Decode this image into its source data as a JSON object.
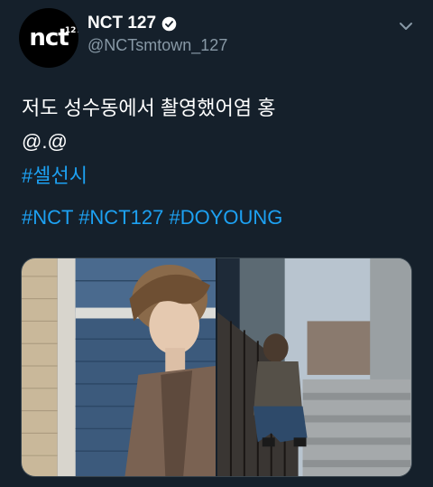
{
  "header": {
    "avatar_logo": "nct",
    "avatar_logo_sup": "127",
    "display_name": "NCT 127",
    "handle": "@NCTsmtown_127"
  },
  "tweet": {
    "line1": "저도 성수동에서 촬영했어염 홍",
    "line2": "@.@",
    "hashtag_line": "#셀선시",
    "hashtags": [
      "#NCT",
      "#NCT127",
      "#DOYOUNG"
    ]
  },
  "media": {
    "photos": [
      "photo-1",
      "photo-2"
    ]
  },
  "colors": {
    "background": "#15202b",
    "link": "#1da1f2",
    "muted": "#8899a6"
  }
}
